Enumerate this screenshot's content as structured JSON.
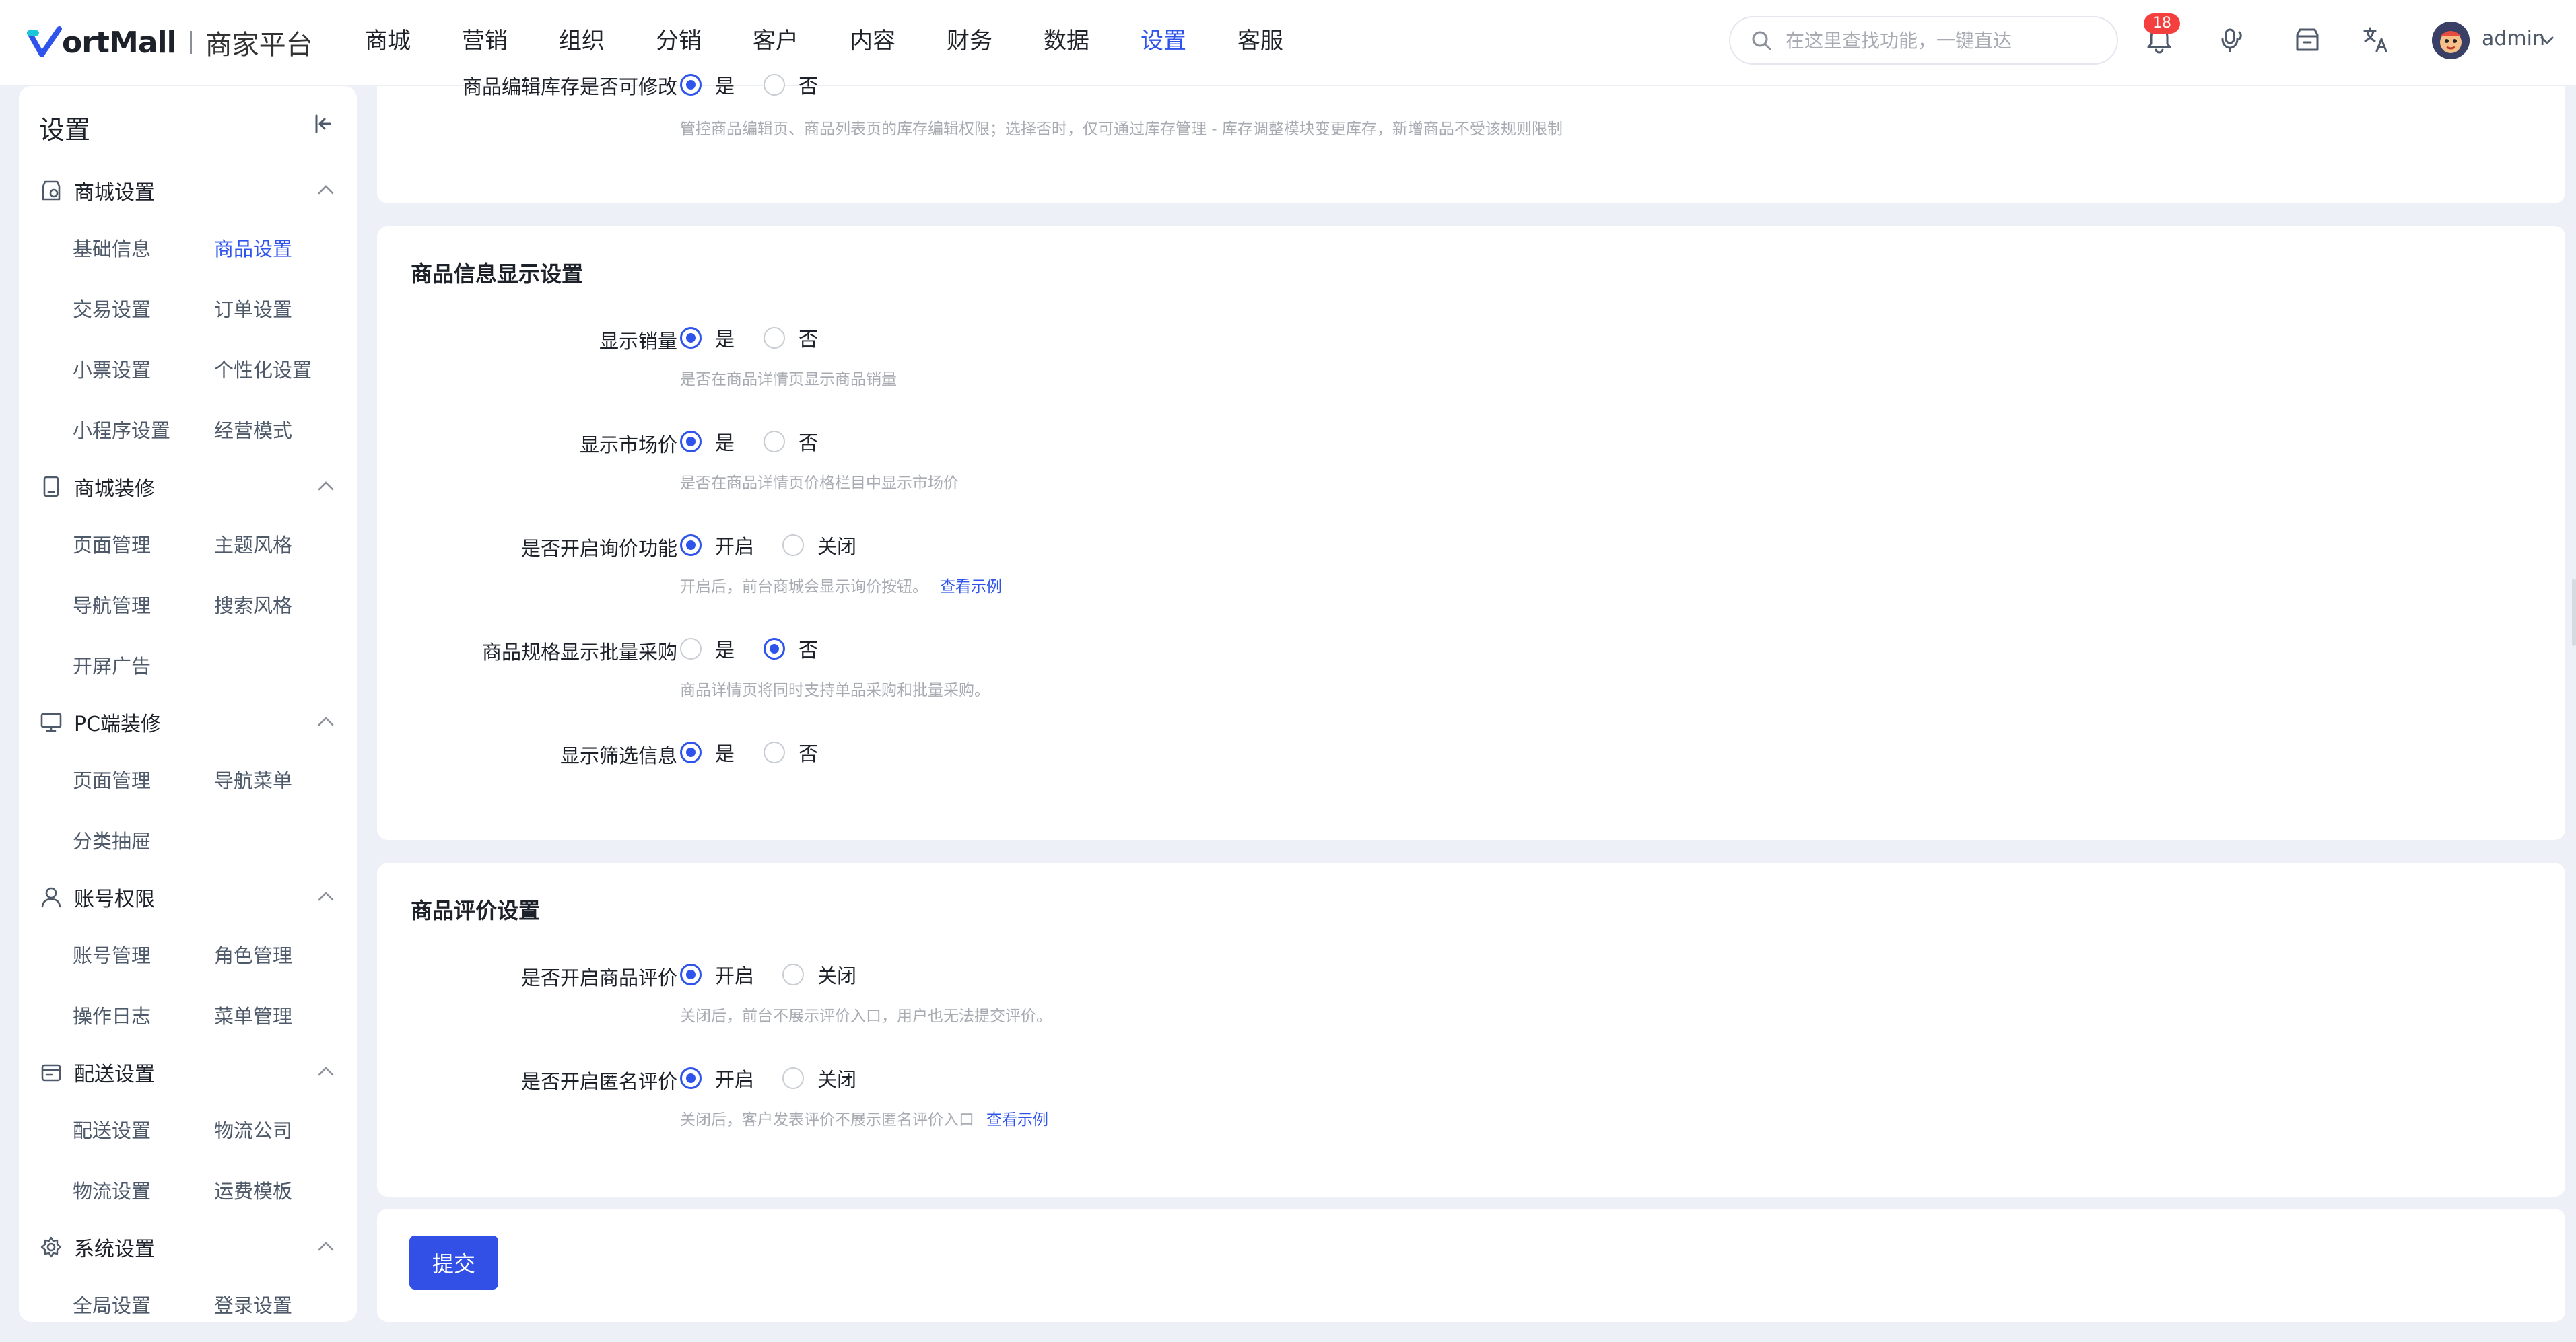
{
  "brand": {
    "name": "ortMall",
    "subtitle": "商家平台"
  },
  "nav": {
    "items": [
      {
        "label": "商城",
        "active": false
      },
      {
        "label": "营销",
        "active": false
      },
      {
        "label": "组织",
        "active": false
      },
      {
        "label": "分销",
        "active": false
      },
      {
        "label": "客户",
        "active": false
      },
      {
        "label": "内容",
        "active": false
      },
      {
        "label": "财务",
        "active": false
      },
      {
        "label": "数据",
        "active": false
      },
      {
        "label": "设置",
        "active": true
      },
      {
        "label": "客服",
        "active": false
      }
    ]
  },
  "search": {
    "placeholder": "在这里查找功能，一键直达"
  },
  "notifications": {
    "count": "18"
  },
  "user": {
    "name": "admin"
  },
  "sidebar": {
    "title": "设置",
    "groups": [
      {
        "label": "商城设置",
        "icon": "store-settings-icon",
        "items": [
          "基础信息",
          "商品设置",
          "交易设置",
          "订单设置",
          "小票设置",
          "个性化设置",
          "小程序设置",
          "经营模式"
        ]
      },
      {
        "label": "商城装修",
        "icon": "tablet-icon",
        "items": [
          "页面管理",
          "主题风格",
          "导航管理",
          "搜索风格",
          "开屏广告"
        ]
      },
      {
        "label": "PC端装修",
        "icon": "monitor-icon",
        "items": [
          "页面管理",
          "导航菜单",
          "分类抽屉"
        ]
      },
      {
        "label": "账号权限",
        "icon": "user-icon",
        "items": [
          "账号管理",
          "角色管理",
          "操作日志",
          "菜单管理"
        ]
      },
      {
        "label": "配送设置",
        "icon": "delivery-icon",
        "items": [
          "配送设置",
          "物流公司",
          "物流设置",
          "运费模板"
        ]
      },
      {
        "label": "系统设置",
        "icon": "system-gear-icon",
        "items": [
          "全局设置",
          "登录设置"
        ]
      }
    ],
    "active_item": "商品设置"
  },
  "top_partial": {
    "label": "商品编辑库存是否可修改",
    "options": [
      "是",
      "否"
    ],
    "selected": "是",
    "help": "管控商品编辑页、商品列表页的库存编辑权限；选择否时，仅可通过库存管理 - 库存调整模块变更库存，新增商品不受该规则限制"
  },
  "display_section": {
    "title": "商品信息显示设置",
    "rows": [
      {
        "label": "显示销量",
        "options": [
          "是",
          "否"
        ],
        "selected": 0,
        "help": "是否在商品详情页显示商品销量",
        "link": ""
      },
      {
        "label": "显示市场价",
        "options": [
          "是",
          "否"
        ],
        "selected": 0,
        "help": "是否在商品详情页价格栏目中显示市场价",
        "link": ""
      },
      {
        "label": "是否开启询价功能",
        "options": [
          "开启",
          "关闭"
        ],
        "selected": 0,
        "help": "开启后，前台商城会显示询价按钮。",
        "link": "查看示例"
      },
      {
        "label": "商品规格显示批量采购",
        "options": [
          "是",
          "否"
        ],
        "selected": 1,
        "help": "商品详情页将同时支持单品采购和批量采购。",
        "link": ""
      },
      {
        "label": "显示筛选信息",
        "options": [
          "是",
          "否"
        ],
        "selected": 0,
        "help": "",
        "link": ""
      }
    ]
  },
  "review_section": {
    "title": "商品评价设置",
    "rows": [
      {
        "label": "是否开启商品评价",
        "options": [
          "开启",
          "关闭"
        ],
        "selected": 0,
        "help": "关闭后，前台不展示评价入口，用户也无法提交评价。",
        "link": ""
      },
      {
        "label": "是否开启匿名评价",
        "options": [
          "开启",
          "关闭"
        ],
        "selected": 0,
        "help": "关闭后，客户发表评价不展示匿名评价入口",
        "link": "查看示例"
      }
    ]
  },
  "submit_label": "提交",
  "colors": {
    "accent": "#2f54eb",
    "button": "#3250e6",
    "badge": "#f53f3f",
    "page_bg": "#eef0f8"
  }
}
